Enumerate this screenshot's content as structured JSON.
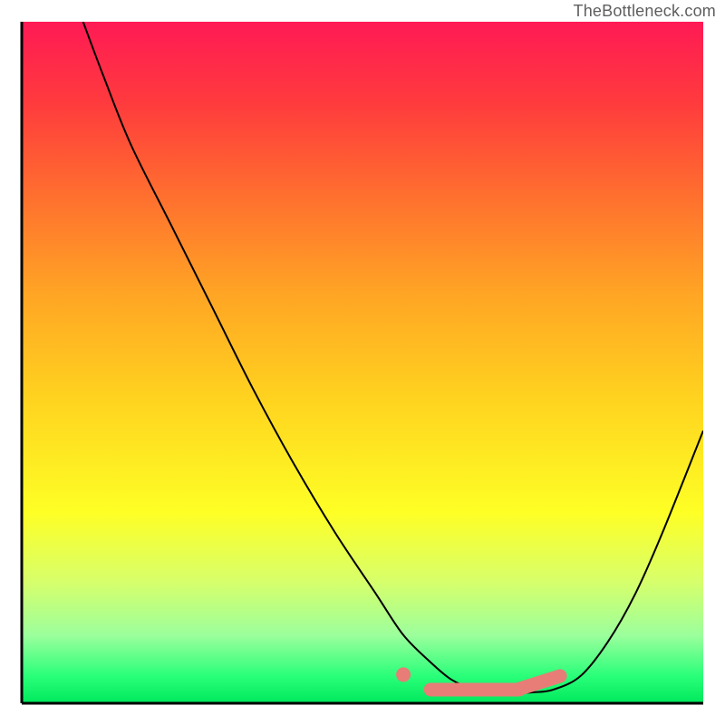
{
  "watermark": "TheBottleneck.com",
  "colors": {
    "axis": "#000000",
    "curve": "#000000",
    "salmon": "#e77d76",
    "gradient_top": "#ff1a55",
    "gradient_bottom": "#00e85c"
  },
  "chart_data": {
    "type": "line",
    "title": "",
    "xlabel": "",
    "ylabel": "",
    "xlim": [
      0,
      100
    ],
    "ylim": [
      0,
      100
    ],
    "series": [
      {
        "name": "bottleneck-curve",
        "x": [
          9,
          12,
          16,
          22,
          28,
          34,
          40,
          46,
          52,
          56,
          60,
          63,
          66,
          69,
          72,
          75,
          78,
          82,
          86,
          90,
          94,
          100
        ],
        "y": [
          100,
          92,
          82,
          70,
          58,
          46,
          35,
          25,
          16,
          10,
          6,
          3.5,
          2.2,
          1.7,
          1.5,
          1.6,
          2,
          4,
          9,
          16,
          25,
          40
        ]
      }
    ],
    "annotations": [
      {
        "name": "left-flat-dot",
        "x": 56,
        "y": 4.2,
        "type": "dot"
      },
      {
        "name": "flat-segment",
        "x0": 60,
        "x1": 73,
        "y": 2.0,
        "type": "thick"
      },
      {
        "name": "right-rise-segment",
        "x0": 73,
        "x1": 79,
        "y0": 2.1,
        "y1": 4.0,
        "type": "thick"
      }
    ]
  }
}
